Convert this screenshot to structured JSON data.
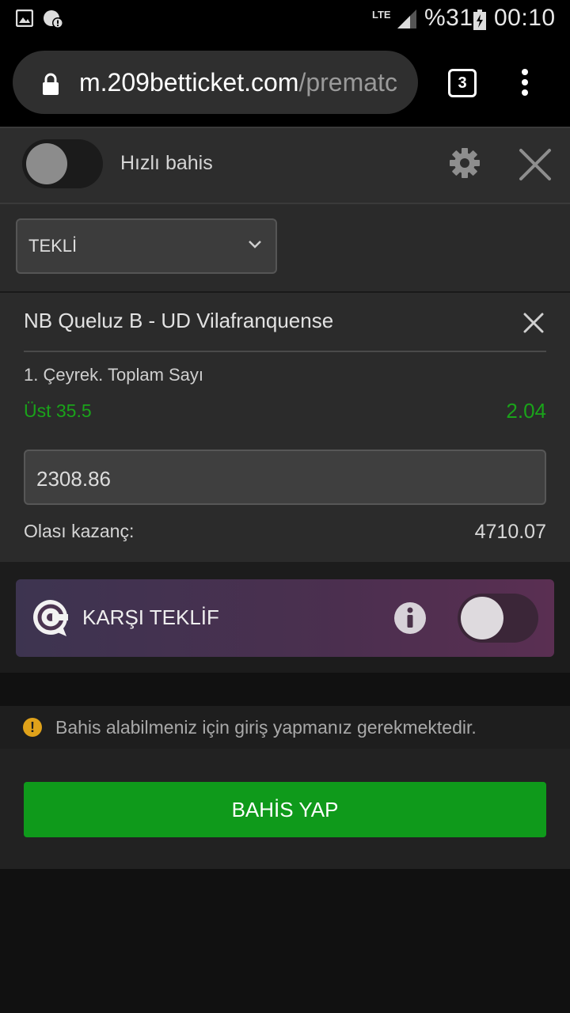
{
  "status_bar": {
    "left_icons": [
      "gallery-icon",
      "data-saver-alert-icon"
    ],
    "network_label": "LTE",
    "battery_percent": "%31",
    "time": "00:10"
  },
  "browser": {
    "url_host": "m.209betticket.com",
    "url_path": "/prematc",
    "tab_count": "3"
  },
  "quick_bet": {
    "label": "Hızlı bahis",
    "enabled": false
  },
  "bet_type": {
    "selected": "TEKLİ"
  },
  "bet": {
    "match": "NB Queluz B - UD Vilafranquense",
    "market": "1. Çeyrek. Toplam Sayı",
    "selection": "Üst 35.5",
    "odds": "2.04",
    "stake": "2308.86",
    "potential_win_label": "Olası kazanç:",
    "potential_win_value": "4710.07"
  },
  "counter_offer": {
    "label": "KARŞI TEKLİF",
    "enabled": false
  },
  "notice": {
    "text": "Bahis alabilmeniz için giriş yapmanız gerekmektedir."
  },
  "actions": {
    "place_bet_label": "BAHİS YAP"
  },
  "colors": {
    "accent_green": "#0f9a1b",
    "odds_green": "#1aa31a",
    "warning": "#e0a21a"
  }
}
